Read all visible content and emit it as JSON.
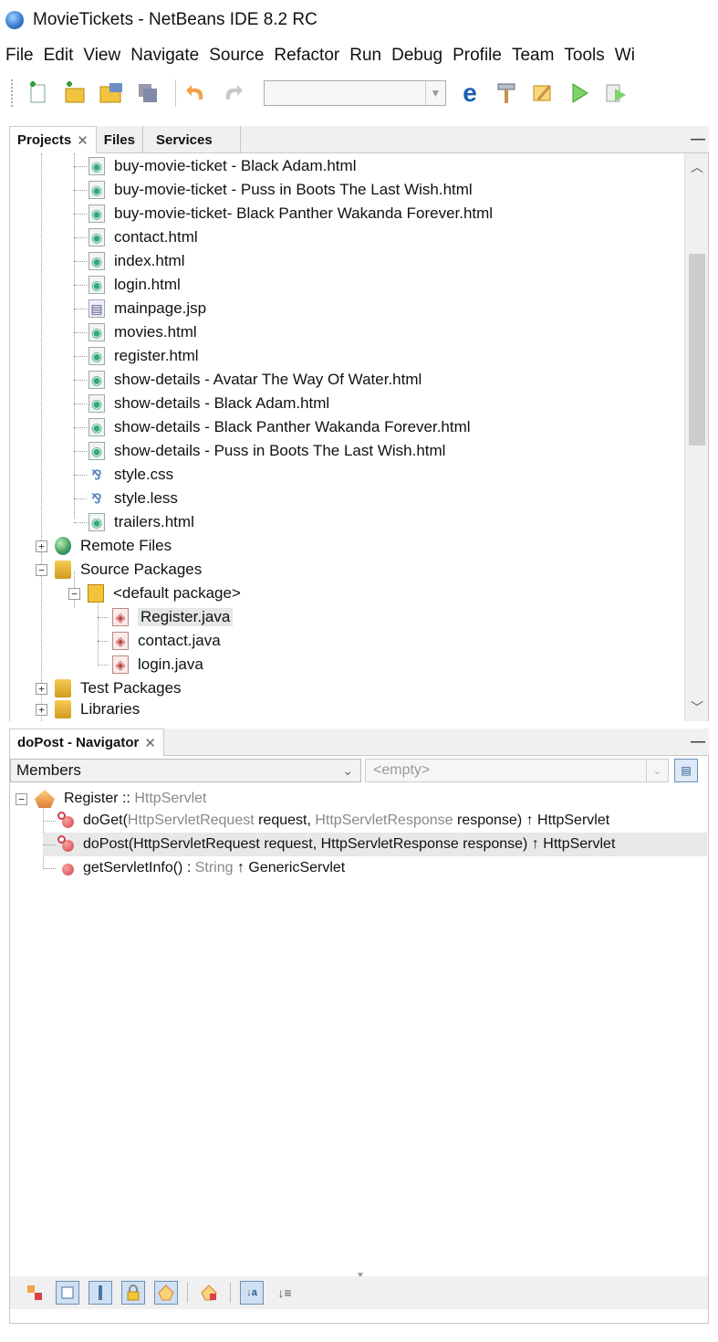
{
  "window": {
    "title": "MovieTickets - NetBeans IDE 8.2 RC"
  },
  "menubar": {
    "items": [
      "File",
      "Edit",
      "View",
      "Navigate",
      "Source",
      "Refactor",
      "Run",
      "Debug",
      "Profile",
      "Team",
      "Tools",
      "Wi"
    ]
  },
  "toolbar": {
    "buttons": [
      "new-file",
      "new-project",
      "open-project",
      "save-all",
      "undo",
      "redo",
      "browser",
      "build",
      "clean-build",
      "run",
      "debug"
    ],
    "config_value": ""
  },
  "projects_panel": {
    "tabs": [
      {
        "label": "Projects",
        "active": true,
        "closable": true
      },
      {
        "label": "Files",
        "active": false,
        "closable": false
      },
      {
        "label": "Services",
        "active": false,
        "closable": false
      }
    ],
    "web_files": [
      {
        "label": "buy-movie-ticket - Black Adam.html",
        "type": "html"
      },
      {
        "label": "buy-movie-ticket - Puss in Boots The Last Wish.html",
        "type": "html"
      },
      {
        "label": "buy-movie-ticket- Black Panther Wakanda Forever.html",
        "type": "html"
      },
      {
        "label": "contact.html",
        "type": "html"
      },
      {
        "label": "index.html",
        "type": "html"
      },
      {
        "label": "login.html",
        "type": "html"
      },
      {
        "label": "mainpage.jsp",
        "type": "jsp"
      },
      {
        "label": "movies.html",
        "type": "html"
      },
      {
        "label": "register.html",
        "type": "html"
      },
      {
        "label": "show-details - Avatar The Way Of Water.html",
        "type": "html"
      },
      {
        "label": "show-details - Black Adam.html",
        "type": "html"
      },
      {
        "label": "show-details - Black Panther Wakanda Forever.html",
        "type": "html"
      },
      {
        "label": "show-details - Puss in Boots The Last Wish.html",
        "type": "html"
      },
      {
        "label": "style.css",
        "type": "css"
      },
      {
        "label": "style.less",
        "type": "less"
      },
      {
        "label": "trailers.html",
        "type": "html"
      }
    ],
    "remote_files": "Remote Files",
    "source_packages": "Source Packages",
    "default_package": "<default package>",
    "java_files": [
      "Register.java",
      "contact.java",
      "login.java"
    ],
    "test_packages": "Test Packages",
    "libraries": "Libraries"
  },
  "navigator_panel": {
    "tab_label": "doPost - Navigator",
    "members_label": "Members",
    "filter_placeholder": "<empty>",
    "class_name": "Register",
    "class_sep": " :: ",
    "class_super": "HttpServlet",
    "members": [
      {
        "name": "doGet(",
        "p1type": "HttpServletRequest",
        "p1": " request, ",
        "p2type": "HttpServletResponse",
        "p2": " response) ",
        "ret": "",
        "inherit": "↑ HttpServlet",
        "override": true,
        "selected": false
      },
      {
        "name": "doPost(",
        "p1type": "HttpServletRequest",
        "p1": " request, ",
        "p2type": "HttpServletResponse",
        "p2": " response) ",
        "ret": "",
        "inherit": "↑ HttpServlet",
        "override": true,
        "selected": true
      },
      {
        "name": "getServletInfo() ",
        "p1type": "",
        "p1": ": ",
        "p2type": "String",
        "p2": " ",
        "ret": "",
        "inherit": "↑ GenericServlet",
        "override": false,
        "selected": false
      }
    ]
  }
}
